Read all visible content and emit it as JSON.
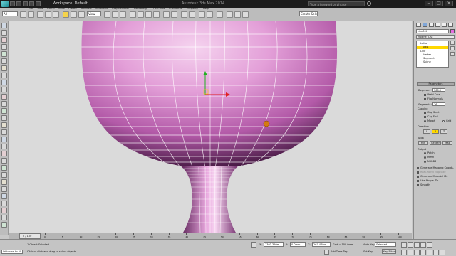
{
  "window": {
    "title": "Workspace: Default",
    "title_center": "Autodesk 3ds Max 2014",
    "search_placeholder": "Type a keyword or phrase"
  },
  "menu": {
    "items": [
      "Edit",
      "Tools",
      "Group",
      "Views",
      "Create",
      "Modifiers",
      "Animation",
      "Graph Editors",
      "Rendering",
      "Civil View",
      "Customize",
      "Scripting",
      "Help"
    ]
  },
  "toolbar": {
    "undo_set": "All",
    "coord_system": "View",
    "named_selection": "Create Selection Se"
  },
  "command_panel": {
    "object_name": "Line006",
    "modifier_list": "Modifier List",
    "stack": [
      {
        "label": "Lathe",
        "selected": false
      },
      {
        "label": "Axis",
        "selected": true
      },
      {
        "label": "Line",
        "selected": false
      },
      {
        "label": "Vertex",
        "selected": false
      },
      {
        "label": "Segment",
        "selected": false
      },
      {
        "label": "Spline",
        "selected": false
      }
    ],
    "parameters_title": "Parameters",
    "degrees_label": "Degrees:",
    "degrees_value": "360.0",
    "weld_core": "Weld Core",
    "flip_normals": "Flip Normals",
    "segments_label": "Segments:",
    "segments_value": "16",
    "capping_title": "Capping",
    "cap_start": "Cap Start",
    "cap_end": "Cap End",
    "morph": "Morph",
    "grid": "Grid",
    "direction_title": "Direction",
    "dir_x": "X",
    "dir_y": "Y",
    "dir_z": "Z",
    "align_title": "Align",
    "align_min": "Min",
    "align_center": "Center",
    "align_max": "Max",
    "output_title": "Output",
    "out_patch": "Patch",
    "out_mesh": "Mesh",
    "out_nurbs": "NURBS",
    "gen_mapping": "Generate Mapping Coords.",
    "real_world": "Real-World Map Size",
    "gen_material": "Generate Material IDs",
    "use_shape_ids": "Use Shape IDs",
    "smooth": "Smooth"
  },
  "timeline": {
    "frame_display": "0 / 100",
    "ticks": [
      "0",
      "5",
      "10",
      "15",
      "20",
      "25",
      "30",
      "35",
      "40",
      "45",
      "50",
      "55",
      "60",
      "65",
      "70",
      "75",
      "80",
      "85",
      "90",
      "95",
      "100"
    ]
  },
  "status": {
    "welcome": "Welcome to M",
    "selection_info": "1 Object Selected",
    "prompt": "Click or click-and-drag to select objects",
    "x_label": "X:",
    "x_value": "1303.399m",
    "y_label": "Y:",
    "y_value": "0.0mm",
    "z_label": "Z:",
    "z_value": "267.449m",
    "grid_value": "Grid = 100.0mm",
    "add_time_tag": "Add Time Tag",
    "auto_key": "Auto Key",
    "set_key": "Set Key",
    "selected": "Selected",
    "key_filters": "Key Filters..."
  },
  "colors": {
    "mesh_light": "#f3c8ec",
    "mesh_mid": "#d27cc4",
    "mesh_dark": "#4a1846",
    "viewport_bg": "#dadada",
    "highlight": "#ffd800"
  }
}
